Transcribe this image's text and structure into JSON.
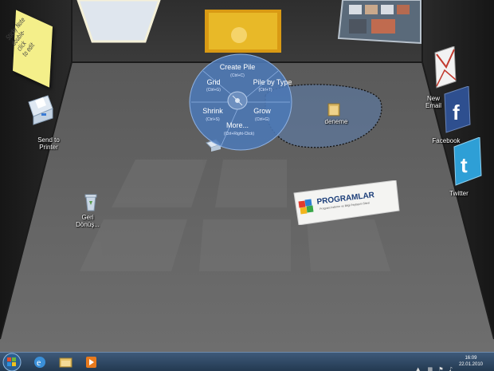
{
  "desktop": {
    "sticky_note_text": "Sticky Note\ndouble-click\nto edit",
    "icons": {
      "send_to_printer": "Send to\nPrinter",
      "recycle_bin": "Geri\nDönüş...",
      "new_email": "New\nEmail",
      "facebook": "Facebook",
      "twitter": "Twitter",
      "folder": "deneme"
    }
  },
  "pie_menu": {
    "create_pile": "Create Pile",
    "create_pile_key": "(Ctrl+C)",
    "grid": "Grid",
    "grid_key": "(Ctrl+G)",
    "pile_by_type": "Pile by Type",
    "pile_by_type_key": "(Ctrl+T)",
    "shrink": "Shrink",
    "shrink_key": "(Ctrl+S)",
    "grow": "Grow",
    "grow_key": "(Ctrl+G)",
    "more": "More...",
    "more_key": "(Ctrl+Right-Click)"
  },
  "banner": {
    "title": "PROGRAMLAR",
    "tagline": "Program İndirme ve Bilgi Paylaşım Sitesi"
  },
  "taskbar": {
    "time": "16:09",
    "date": "22.01.2010"
  },
  "colors": {
    "pie_fill": "#4c79b6",
    "pile_fill": "#5d7fb0",
    "taskbar": "#2c4562"
  }
}
